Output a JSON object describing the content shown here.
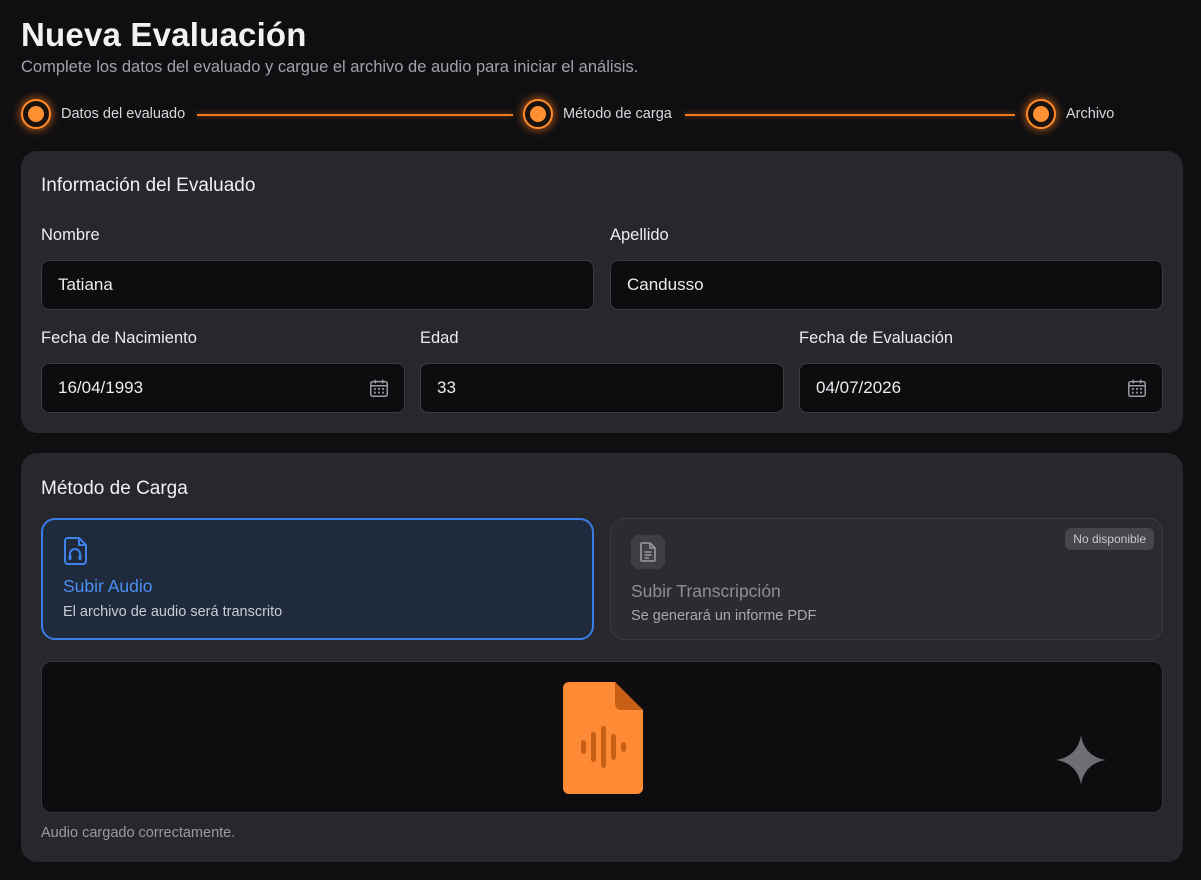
{
  "header": {
    "title": "Nueva Evaluación",
    "subtitle": "Complete los datos del evaluado y cargue el archivo de audio para iniciar el análisis."
  },
  "stepper": {
    "steps": [
      {
        "label": "Datos del evaluado"
      },
      {
        "label": "Método de carga"
      },
      {
        "label": "Archivo"
      }
    ]
  },
  "evaluado": {
    "title": "Información del Evaluado",
    "nombre": {
      "label": "Nombre",
      "value": "Tatiana"
    },
    "apellido": {
      "label": "Apellido",
      "value": "Candusso"
    },
    "fecha_nacimiento": {
      "label": "Fecha de Nacimiento",
      "value": "16/04/1993"
    },
    "edad": {
      "label": "Edad",
      "value": "33"
    },
    "fecha_evaluacion": {
      "label": "Fecha de Evaluación",
      "value": "04/07/2026"
    }
  },
  "metodo": {
    "title": "Método de Carga",
    "audio": {
      "title": "Subir Audio",
      "description": "El archivo de audio será transcrito",
      "icon": "audio-file-icon"
    },
    "transcripcion": {
      "title": "Subir Transcripción",
      "description": "Se generará un informe PDF",
      "badge": "No disponible",
      "icon": "document-icon"
    },
    "status": "Audio cargado correctamente."
  },
  "colors": {
    "accent": "#ff8a2a",
    "selected_border": "#3b7be6",
    "selected_text": "#4a8ef0",
    "file_icon": "#ff8a35"
  }
}
